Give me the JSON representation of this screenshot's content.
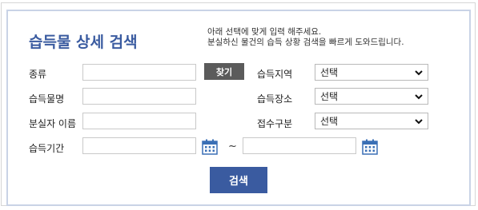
{
  "title": "습득물 상세 검색",
  "description": [
    "아래 선택에 맞게 입력 해주세요.",
    "분실하신 물건의 습득 상황 검색을 빠르게 도와드립니다."
  ],
  "fields": {
    "type": {
      "label": "종류",
      "value": "",
      "find_button": "찾기"
    },
    "item_name": {
      "label": "습득물명",
      "value": ""
    },
    "owner_name": {
      "label": "분실자 이름",
      "value": ""
    },
    "period": {
      "label": "습득기간",
      "start": "",
      "end": "",
      "separator": "~"
    }
  },
  "selects": {
    "region": {
      "label": "습득지역",
      "value": "선택"
    },
    "place": {
      "label": "습득장소",
      "value": "선택"
    },
    "receipt_type": {
      "label": "접수구분",
      "value": "선택"
    }
  },
  "icons": {
    "calendar": "calendar-icon",
    "chevron": "chevron-down-icon"
  },
  "colors": {
    "accent": "#3a5ba0",
    "find_button": "#5b5b5b",
    "panel_border": "#c9d3e6"
  },
  "search_button": "검색"
}
